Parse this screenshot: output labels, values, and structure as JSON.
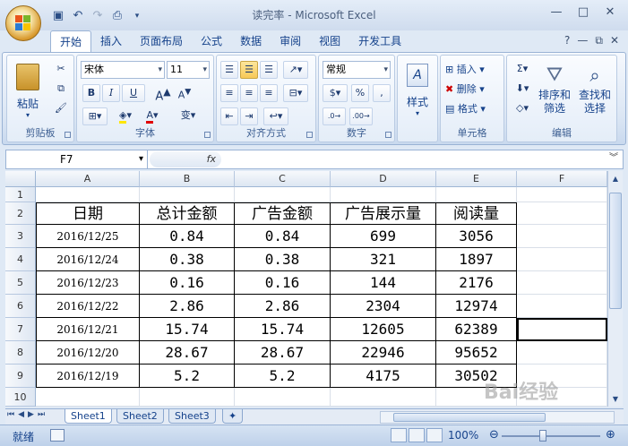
{
  "window": {
    "title": "读完率 - Microsoft Excel"
  },
  "ribbon_tabs": [
    "开始",
    "插入",
    "页面布局",
    "公式",
    "数据",
    "审阅",
    "视图",
    "开发工具"
  ],
  "clipboard": {
    "paste": "粘贴",
    "label": "剪贴板"
  },
  "font": {
    "name": "宋体",
    "size": "11",
    "label": "字体",
    "bold": "B",
    "italic": "I",
    "underline": "U"
  },
  "alignment": {
    "label": "对齐方式"
  },
  "number": {
    "format": "常规",
    "label": "数字",
    "percent": "%",
    "comma": ","
  },
  "styles": {
    "label": "样式"
  },
  "cells": {
    "insert": "插入",
    "delete": "删除",
    "format": "格式",
    "label": "单元格"
  },
  "editing": {
    "sort_filter": "排序和\n筛选",
    "find_select": "查找和\n选择",
    "label": "编辑"
  },
  "formula_bar": {
    "name_box": "F7",
    "fx": "fx",
    "value": ""
  },
  "columns": [
    "A",
    "B",
    "C",
    "D",
    "E",
    "F"
  ],
  "rows": [
    "1",
    "2",
    "3",
    "4",
    "5",
    "6",
    "7",
    "8",
    "9",
    "10"
  ],
  "table": {
    "headers": [
      "日期",
      "总计金额",
      "广告金额",
      "广告展示量",
      "阅读量"
    ],
    "rows": [
      [
        "2016/12/25",
        "0.84",
        "0.84",
        "699",
        "3056"
      ],
      [
        "2016/12/24",
        "0.38",
        "0.38",
        "321",
        "1897"
      ],
      [
        "2016/12/23",
        "0.16",
        "0.16",
        "144",
        "2176"
      ],
      [
        "2016/12/22",
        "2.86",
        "2.86",
        "2304",
        "12974"
      ],
      [
        "2016/12/21",
        "15.74",
        "15.74",
        "12605",
        "62389"
      ],
      [
        "2016/12/20",
        "28.67",
        "28.67",
        "22946",
        "95652"
      ],
      [
        "2016/12/19",
        "5.2",
        "5.2",
        "4175",
        "30502"
      ]
    ]
  },
  "sheets": [
    "Sheet1",
    "Sheet2",
    "Sheet3"
  ],
  "status": {
    "ready": "就绪",
    "zoom": "100%"
  },
  "watermark": "Bai经验"
}
